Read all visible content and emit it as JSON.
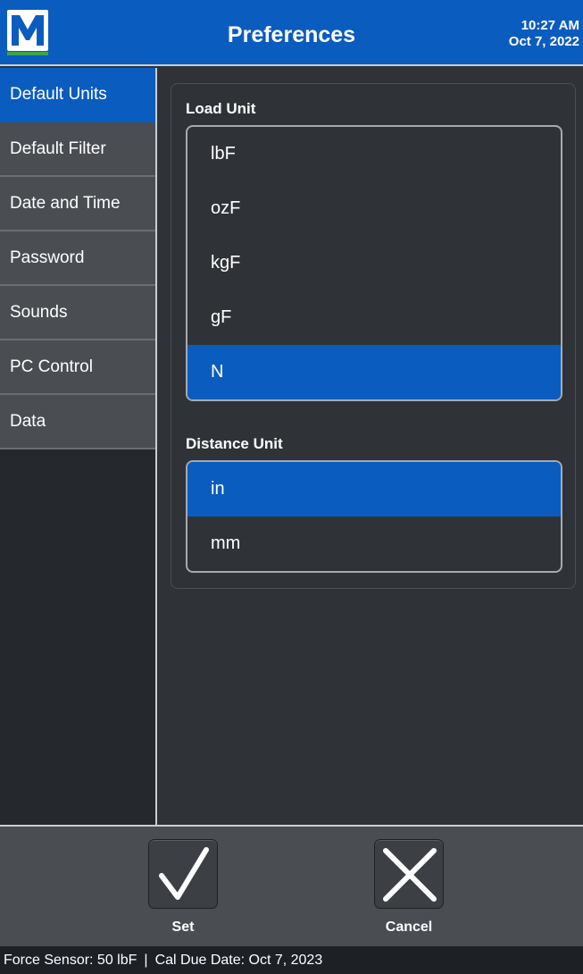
{
  "header": {
    "logo_letter": "M",
    "title": "Preferences",
    "time": "10:27 AM",
    "date": "Oct 7, 2022"
  },
  "sidebar": {
    "items": [
      {
        "label": "Default Units",
        "active": true
      },
      {
        "label": "Default Filter",
        "active": false
      },
      {
        "label": "Date and Time",
        "active": false
      },
      {
        "label": "Password",
        "active": false
      },
      {
        "label": "Sounds",
        "active": false
      },
      {
        "label": "PC Control",
        "active": false
      },
      {
        "label": "Data",
        "active": false
      }
    ]
  },
  "load_unit": {
    "label": "Load Unit",
    "options": [
      "lbF",
      "ozF",
      "kgF",
      "gF",
      "N"
    ],
    "selected": "N"
  },
  "distance_unit": {
    "label": "Distance Unit",
    "options": [
      "in",
      "mm"
    ],
    "selected": "in"
  },
  "footer": {
    "set_label": "Set",
    "cancel_label": "Cancel"
  },
  "status_bar": {
    "sensor": "Force Sensor: 50 lbF",
    "separator": "|",
    "cal_due": "Cal Due Date: Oct 7, 2023"
  },
  "colors": {
    "accent": "#0b5cbf",
    "logo_underline": "#3aa64a",
    "background": "#2f3338"
  }
}
